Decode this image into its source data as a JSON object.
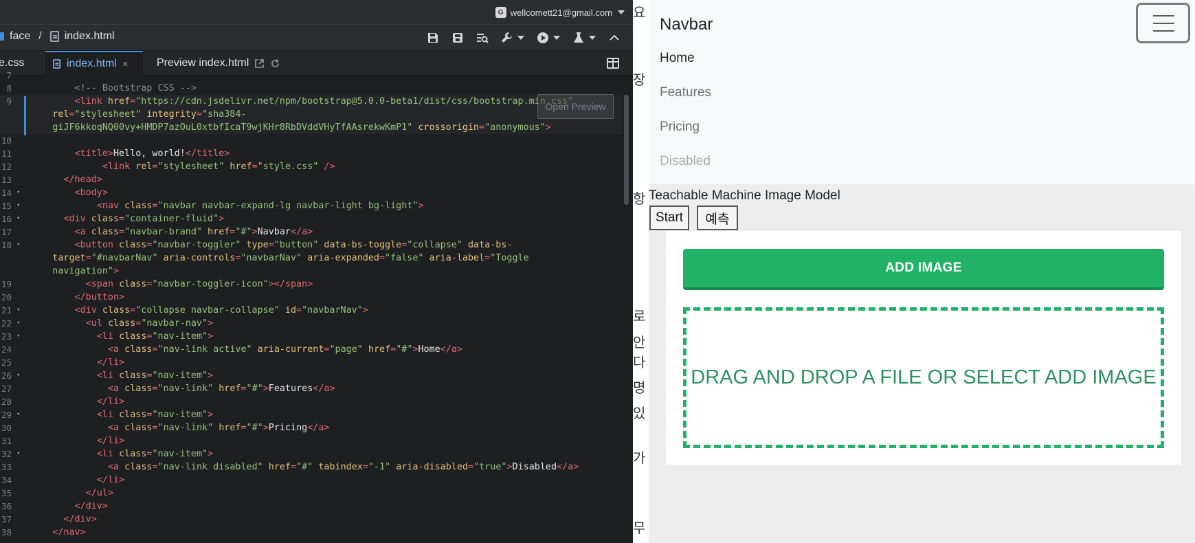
{
  "editor": {
    "account": {
      "email": "wellcomett21@gmail.com",
      "icon": "google-icon"
    },
    "breadcrumb": {
      "folder": "face",
      "separator": "/",
      "file": "index.html"
    },
    "tabs": [
      {
        "label": "e.css"
      },
      {
        "label": "index.html",
        "close": "×"
      },
      {
        "label": "Preview index.html"
      }
    ],
    "open_preview": "Open Preview",
    "lines": [
      {
        "n": "7",
        "fold": false,
        "indent": 0,
        "tokens": []
      },
      {
        "n": "8",
        "fold": false,
        "indent": 8,
        "tokens": [
          [
            "cm",
            "<!-- Bootstrap CSS -->"
          ]
        ]
      },
      {
        "n": "9",
        "fold": false,
        "indent": 8,
        "hl": true,
        "tokens": [
          [
            "punc",
            "<"
          ],
          [
            "tag",
            "link "
          ],
          [
            "attr",
            "href"
          ],
          [
            "punc",
            "="
          ],
          [
            "str",
            "\"https://cdn.jsdelivr.net/npm/bootstrap@5.0.0-beta1/dist/css/bootstrap.min.css\""
          ]
        ]
      },
      {
        "n": "",
        "fold": false,
        "indent": 4,
        "hl": true,
        "tokens": [
          [
            "attr",
            "rel"
          ],
          [
            "punc",
            "="
          ],
          [
            "str",
            "\"stylesheet\" "
          ],
          [
            "attr",
            "integrity"
          ],
          [
            "punc",
            "="
          ],
          [
            "str",
            "\"sha384-"
          ]
        ]
      },
      {
        "n": "",
        "fold": false,
        "indent": 4,
        "hl": true,
        "tokens": [
          [
            "str",
            "giJF6kkoqNQ00vy+HMDP7azOuL0xtbfIcaT9wjKHr8RbDVddVHyTfAAsrekwKmP1\" "
          ],
          [
            "attr",
            "crossorigin"
          ],
          [
            "punc",
            "="
          ],
          [
            "str",
            "\"anonymous\""
          ],
          [
            "punc",
            ">"
          ]
        ]
      },
      {
        "n": "10",
        "fold": false,
        "indent": 0,
        "tokens": []
      },
      {
        "n": "11",
        "fold": false,
        "indent": 8,
        "tokens": [
          [
            "punc",
            "<"
          ],
          [
            "tag",
            "title"
          ],
          [
            "punc",
            ">"
          ],
          [
            "txt",
            "Hello, world!"
          ],
          [
            "punc",
            "</"
          ],
          [
            "tag",
            "title"
          ],
          [
            "punc",
            ">"
          ]
        ]
      },
      {
        "n": "12",
        "fold": false,
        "indent": 13,
        "tokens": [
          [
            "punc",
            "<"
          ],
          [
            "tag",
            "link "
          ],
          [
            "attr",
            "rel"
          ],
          [
            "punc",
            "="
          ],
          [
            "str",
            "\"stylesheet\" "
          ],
          [
            "attr",
            "href"
          ],
          [
            "punc",
            "="
          ],
          [
            "str",
            "\"style.css\" "
          ],
          [
            "punc",
            "/>"
          ]
        ]
      },
      {
        "n": "13",
        "fold": false,
        "indent": 6,
        "tokens": [
          [
            "punc",
            "</"
          ],
          [
            "tag",
            "head"
          ],
          [
            "punc",
            ">"
          ]
        ]
      },
      {
        "n": "14",
        "fold": true,
        "indent": 8,
        "tokens": [
          [
            "punc",
            "<"
          ],
          [
            "tag",
            "body"
          ],
          [
            "punc",
            ">"
          ]
        ]
      },
      {
        "n": "15",
        "fold": true,
        "indent": 12,
        "tokens": [
          [
            "punc",
            "<"
          ],
          [
            "tag",
            "nav "
          ],
          [
            "attr",
            "class"
          ],
          [
            "punc",
            "="
          ],
          [
            "str",
            "\"navbar navbar-expand-lg navbar-light bg-light\""
          ],
          [
            "punc",
            ">"
          ]
        ]
      },
      {
        "n": "16",
        "fold": true,
        "indent": 6,
        "tokens": [
          [
            "punc",
            "<"
          ],
          [
            "tag",
            "div "
          ],
          [
            "attr",
            "class"
          ],
          [
            "punc",
            "="
          ],
          [
            "str",
            "\"container-fluid\""
          ],
          [
            "punc",
            ">"
          ]
        ]
      },
      {
        "n": "17",
        "fold": false,
        "indent": 8,
        "tokens": [
          [
            "punc",
            "<"
          ],
          [
            "tag",
            "a "
          ],
          [
            "attr",
            "class"
          ],
          [
            "punc",
            "="
          ],
          [
            "str",
            "\"navbar-brand\" "
          ],
          [
            "attr",
            "href"
          ],
          [
            "punc",
            "="
          ],
          [
            "str",
            "\"#\""
          ],
          [
            "punc",
            ">"
          ],
          [
            "txt",
            "Navbar"
          ],
          [
            "punc",
            "</"
          ],
          [
            "tag",
            "a"
          ],
          [
            "punc",
            ">"
          ]
        ]
      },
      {
        "n": "18",
        "fold": true,
        "indent": 8,
        "tokens": [
          [
            "punc",
            "<"
          ],
          [
            "tag",
            "button "
          ],
          [
            "attr",
            "class"
          ],
          [
            "punc",
            "="
          ],
          [
            "str",
            "\"navbar-toggler\" "
          ],
          [
            "attr",
            "type"
          ],
          [
            "punc",
            "="
          ],
          [
            "str",
            "\"button\" "
          ],
          [
            "attr",
            "data-bs-toggle"
          ],
          [
            "punc",
            "="
          ],
          [
            "str",
            "\"collapse\" "
          ],
          [
            "attr",
            "data-bs-"
          ]
        ]
      },
      {
        "n": "",
        "fold": false,
        "indent": 4,
        "tokens": [
          [
            "attr",
            "target"
          ],
          [
            "punc",
            "="
          ],
          [
            "str",
            "\"#navbarNav\" "
          ],
          [
            "attr",
            "aria-controls"
          ],
          [
            "punc",
            "="
          ],
          [
            "str",
            "\"navbarNav\" "
          ],
          [
            "attr",
            "aria-expanded"
          ],
          [
            "punc",
            "="
          ],
          [
            "str",
            "\"false\" "
          ],
          [
            "attr",
            "aria-label"
          ],
          [
            "punc",
            "="
          ],
          [
            "str",
            "\"Toggle"
          ]
        ]
      },
      {
        "n": "",
        "fold": false,
        "indent": 4,
        "tokens": [
          [
            "str",
            "navigation\""
          ],
          [
            "punc",
            ">"
          ]
        ]
      },
      {
        "n": "19",
        "fold": false,
        "indent": 10,
        "tokens": [
          [
            "punc",
            "<"
          ],
          [
            "tag",
            "span "
          ],
          [
            "attr",
            "class"
          ],
          [
            "punc",
            "="
          ],
          [
            "str",
            "\"navbar-toggler-icon\""
          ],
          [
            "punc",
            "></"
          ],
          [
            "tag",
            "span"
          ],
          [
            "punc",
            ">"
          ]
        ]
      },
      {
        "n": "20",
        "fold": false,
        "indent": 8,
        "tokens": [
          [
            "punc",
            "</"
          ],
          [
            "tag",
            "button"
          ],
          [
            "punc",
            ">"
          ]
        ]
      },
      {
        "n": "21",
        "fold": true,
        "indent": 8,
        "tokens": [
          [
            "punc",
            "<"
          ],
          [
            "tag",
            "div "
          ],
          [
            "attr",
            "class"
          ],
          [
            "punc",
            "="
          ],
          [
            "str",
            "\"collapse navbar-collapse\" "
          ],
          [
            "attr",
            "id"
          ],
          [
            "punc",
            "="
          ],
          [
            "str",
            "\"navbarNav\""
          ],
          [
            "punc",
            ">"
          ]
        ]
      },
      {
        "n": "22",
        "fold": true,
        "indent": 10,
        "tokens": [
          [
            "punc",
            "<"
          ],
          [
            "tag",
            "ul "
          ],
          [
            "attr",
            "class"
          ],
          [
            "punc",
            "="
          ],
          [
            "str",
            "\"navbar-nav\""
          ],
          [
            "punc",
            ">"
          ]
        ]
      },
      {
        "n": "23",
        "fold": true,
        "indent": 12,
        "tokens": [
          [
            "punc",
            "<"
          ],
          [
            "tag",
            "li "
          ],
          [
            "attr",
            "class"
          ],
          [
            "punc",
            "="
          ],
          [
            "str",
            "\"nav-item\""
          ],
          [
            "punc",
            ">"
          ]
        ]
      },
      {
        "n": "24",
        "fold": false,
        "indent": 14,
        "tokens": [
          [
            "punc",
            "<"
          ],
          [
            "tag",
            "a "
          ],
          [
            "attr",
            "class"
          ],
          [
            "punc",
            "="
          ],
          [
            "str",
            "\"nav-link active\" "
          ],
          [
            "attr",
            "aria-current"
          ],
          [
            "punc",
            "="
          ],
          [
            "str",
            "\"page\" "
          ],
          [
            "attr",
            "href"
          ],
          [
            "punc",
            "="
          ],
          [
            "str",
            "\"#\""
          ],
          [
            "punc",
            ">"
          ],
          [
            "txt",
            "Home"
          ],
          [
            "punc",
            "</"
          ],
          [
            "tag",
            "a"
          ],
          [
            "punc",
            ">"
          ]
        ]
      },
      {
        "n": "25",
        "fold": false,
        "indent": 12,
        "tokens": [
          [
            "punc",
            "</"
          ],
          [
            "tag",
            "li"
          ],
          [
            "punc",
            ">"
          ]
        ]
      },
      {
        "n": "26",
        "fold": true,
        "indent": 12,
        "tokens": [
          [
            "punc",
            "<"
          ],
          [
            "tag",
            "li "
          ],
          [
            "attr",
            "class"
          ],
          [
            "punc",
            "="
          ],
          [
            "str",
            "\"nav-item\""
          ],
          [
            "punc",
            ">"
          ]
        ]
      },
      {
        "n": "27",
        "fold": false,
        "indent": 14,
        "tokens": [
          [
            "punc",
            "<"
          ],
          [
            "tag",
            "a "
          ],
          [
            "attr",
            "class"
          ],
          [
            "punc",
            "="
          ],
          [
            "str",
            "\"nav-link\" "
          ],
          [
            "attr",
            "href"
          ],
          [
            "punc",
            "="
          ],
          [
            "str",
            "\"#\""
          ],
          [
            "punc",
            ">"
          ],
          [
            "txt",
            "Features"
          ],
          [
            "punc",
            "</"
          ],
          [
            "tag",
            "a"
          ],
          [
            "punc",
            ">"
          ]
        ]
      },
      {
        "n": "28",
        "fold": false,
        "indent": 12,
        "tokens": [
          [
            "punc",
            "</"
          ],
          [
            "tag",
            "li"
          ],
          [
            "punc",
            ">"
          ]
        ]
      },
      {
        "n": "29",
        "fold": true,
        "indent": 12,
        "tokens": [
          [
            "punc",
            "<"
          ],
          [
            "tag",
            "li "
          ],
          [
            "attr",
            "class"
          ],
          [
            "punc",
            "="
          ],
          [
            "str",
            "\"nav-item\""
          ],
          [
            "punc",
            ">"
          ]
        ]
      },
      {
        "n": "30",
        "fold": false,
        "indent": 14,
        "tokens": [
          [
            "punc",
            "<"
          ],
          [
            "tag",
            "a "
          ],
          [
            "attr",
            "class"
          ],
          [
            "punc",
            "="
          ],
          [
            "str",
            "\"nav-link\" "
          ],
          [
            "attr",
            "href"
          ],
          [
            "punc",
            "="
          ],
          [
            "str",
            "\"#\""
          ],
          [
            "punc",
            ">"
          ],
          [
            "txt",
            "Pricing"
          ],
          [
            "punc",
            "</"
          ],
          [
            "tag",
            "a"
          ],
          [
            "punc",
            ">"
          ]
        ]
      },
      {
        "n": "31",
        "fold": false,
        "indent": 12,
        "tokens": [
          [
            "punc",
            "</"
          ],
          [
            "tag",
            "li"
          ],
          [
            "punc",
            ">"
          ]
        ]
      },
      {
        "n": "32",
        "fold": true,
        "indent": 12,
        "tokens": [
          [
            "punc",
            "<"
          ],
          [
            "tag",
            "li "
          ],
          [
            "attr",
            "class"
          ],
          [
            "punc",
            "="
          ],
          [
            "str",
            "\"nav-item\""
          ],
          [
            "punc",
            ">"
          ]
        ]
      },
      {
        "n": "33",
        "fold": false,
        "indent": 14,
        "tokens": [
          [
            "punc",
            "<"
          ],
          [
            "tag",
            "a "
          ],
          [
            "attr",
            "class"
          ],
          [
            "punc",
            "="
          ],
          [
            "str",
            "\"nav-link disabled\" "
          ],
          [
            "attr",
            "href"
          ],
          [
            "punc",
            "="
          ],
          [
            "str",
            "\"#\" "
          ],
          [
            "attr",
            "tabindex"
          ],
          [
            "punc",
            "="
          ],
          [
            "str",
            "\"-1\" "
          ],
          [
            "attr",
            "aria-disabled"
          ],
          [
            "punc",
            "="
          ],
          [
            "str",
            "\"true\""
          ],
          [
            "punc",
            ">"
          ],
          [
            "txt",
            "Disabled"
          ],
          [
            "punc",
            "</"
          ],
          [
            "tag",
            "a"
          ],
          [
            "punc",
            ">"
          ]
        ]
      },
      {
        "n": "34",
        "fold": false,
        "indent": 12,
        "tokens": [
          [
            "punc",
            "</"
          ],
          [
            "tag",
            "li"
          ],
          [
            "punc",
            ">"
          ]
        ]
      },
      {
        "n": "35",
        "fold": false,
        "indent": 10,
        "tokens": [
          [
            "punc",
            "</"
          ],
          [
            "tag",
            "ul"
          ],
          [
            "punc",
            ">"
          ]
        ]
      },
      {
        "n": "36",
        "fold": false,
        "indent": 8,
        "tokens": [
          [
            "punc",
            "</"
          ],
          [
            "tag",
            "div"
          ],
          [
            "punc",
            ">"
          ]
        ]
      },
      {
        "n": "37",
        "fold": false,
        "indent": 6,
        "tokens": [
          [
            "punc",
            "</"
          ],
          [
            "tag",
            "div"
          ],
          [
            "punc",
            ">"
          ]
        ]
      },
      {
        "n": "38",
        "fold": false,
        "indent": 4,
        "tokens": [
          [
            "punc",
            "</"
          ],
          [
            "tag",
            "nav"
          ],
          [
            "punc",
            ">"
          ]
        ]
      }
    ]
  },
  "splitter_glyphs": [
    "요",
    "장",
    "로",
    "안다",
    "명",
    "있",
    "가",
    "무",
    "항"
  ],
  "preview": {
    "brand": "Navbar",
    "nav": [
      {
        "label": "Home",
        "state": "active"
      },
      {
        "label": "Features",
        "state": "normal"
      },
      {
        "label": "Pricing",
        "state": "normal"
      },
      {
        "label": "Disabled",
        "state": "disabled"
      }
    ],
    "title": "Teachable Machine Image Model",
    "buttons": {
      "start": "Start",
      "predict": "예측"
    },
    "uploader": {
      "add_image": "ADD IMAGE",
      "drop_text": "DRAG AND DROP A FILE OR SELECT ADD IMAGE"
    }
  },
  "colors": {
    "accent_blue": "#3d8fe0",
    "upload_green": "#21b167",
    "tag": "#e06c75",
    "attr": "#e5c07b",
    "string": "#98c379",
    "comment": "#8a8f98"
  }
}
